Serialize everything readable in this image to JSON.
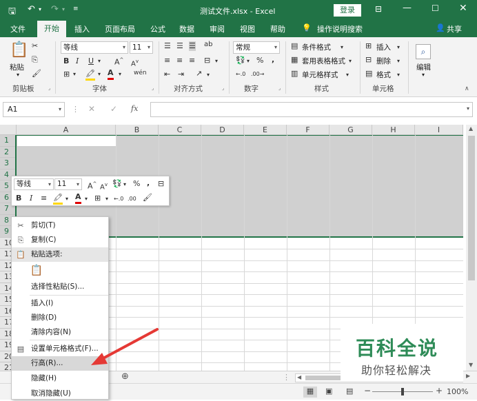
{
  "title_bar": {
    "doc_title": "测试文件.xlsx  -  Excel",
    "login_label": "登录",
    "accent": "#217346"
  },
  "tabs": [
    {
      "label": "文件"
    },
    {
      "label": "开始"
    },
    {
      "label": "插入"
    },
    {
      "label": "页面布局"
    },
    {
      "label": "公式"
    },
    {
      "label": "数据"
    },
    {
      "label": "审阅"
    },
    {
      "label": "视图"
    },
    {
      "label": "帮助"
    },
    {
      "label": "操作说明搜索"
    }
  ],
  "share_label": "共享",
  "ribbon": {
    "paste_label": "粘贴",
    "font_name": "等线",
    "font_size": "11",
    "number_format": "常规",
    "cond_format": "条件格式",
    "table_format": "套用表格格式",
    "cell_style": "单元格样式",
    "insert": "插入",
    "delete": "删除",
    "format": "格式",
    "edit": "编辑",
    "groups": [
      "剪贴板",
      "字体",
      "对齐方式",
      "数字",
      "样式",
      "单元格"
    ]
  },
  "formula_bar": {
    "name_box": "A1",
    "fx": "fx"
  },
  "columns": [
    "A",
    "B",
    "C",
    "D",
    "E",
    "F",
    "G",
    "H",
    "I"
  ],
  "rows": [
    "1",
    "2",
    "3",
    "4",
    "5",
    "6",
    "7",
    "8",
    "9",
    "10",
    "11",
    "12",
    "13",
    "14",
    "15",
    "16",
    "17",
    "18",
    "19",
    "20",
    "21"
  ],
  "mini_toolbar": {
    "font_name": "等线",
    "font_size": "11"
  },
  "context_menu": {
    "cut": "剪切(T)",
    "copy": "复制(C)",
    "paste_options": "粘贴选项:",
    "paste_special": "选择性粘贴(S)...",
    "insert": "插入(I)",
    "delete": "删除(D)",
    "clear": "清除内容(N)",
    "format_cells": "设置单元格格式(F)...",
    "row_height": "行高(R)...",
    "hide": "隐藏(H)",
    "unhide": "取消隐藏(U)"
  },
  "status": {
    "zoom": "100%"
  },
  "watermark": {
    "title": "百科全说",
    "subtitle": "助你轻松解决"
  }
}
